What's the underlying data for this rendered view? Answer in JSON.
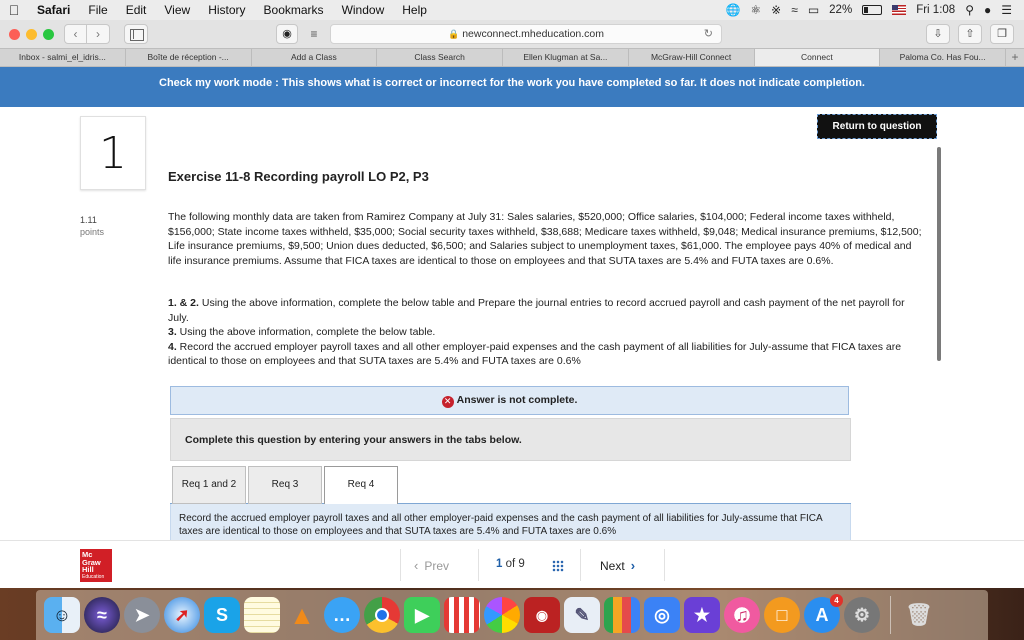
{
  "menubar": {
    "apple": "",
    "items": [
      "Safari",
      "File",
      "Edit",
      "View",
      "History",
      "Bookmarks",
      "Window",
      "Help"
    ],
    "battery": "22%",
    "clock": "Fri 1:08"
  },
  "toolbar": {
    "url": "newconnect.mheducation.com"
  },
  "tabs": [
    "Inbox - salmi_el_idris...",
    "Boîte de réception -...",
    "Add a Class",
    "Class Search",
    "Ellen Klugman at Sa...",
    "McGraw-Hill Connect",
    "Connect",
    "Paloma Co. Has Fou..."
  ],
  "active_tab_index": 6,
  "banner": {
    "text": "Check my work mode : This shows what is correct or incorrect for the work you have completed so far. It does not indicate completion."
  },
  "question": {
    "number": "1",
    "return_label": "Return to question",
    "title": "Exercise 11-8 Recording payroll LO P2, P3",
    "points_value": "1.11",
    "points_unit": "points",
    "body": "The following monthly data are taken from Ramirez Company at July 31: Sales salaries, $520,000; Office salaries, $104,000; Federal income taxes withheld, $156,000; State income taxes withheld, $35,000; Social security taxes withheld, $38,688; Medicare taxes withheld, $9,048; Medical insurance premiums, $12,500; Life insurance premiums, $9,500; Union dues deducted, $6,500; and Salaries subject to unemployment taxes, $61,000. The employee pays 40% of medical and life insurance premiums. Assume that FICA taxes are identical to those on employees and that SUTA taxes are 5.4% and FUTA taxes are 0.6%.",
    "instructions": [
      {
        "num": "1. & 2.",
        "text": " Using the above information, complete the below table and Prepare the journal entries to record accrued payroll and cash payment of the net payroll for July."
      },
      {
        "num": "3.",
        "text": " Using the above information, complete the below table."
      },
      {
        "num": "4.",
        "text": " Record the accrued employer payroll taxes and all other employer-paid expenses and the cash payment of all liabilities for July-assume that FICA taxes are identical to those on employees and that SUTA taxes are 5.4% and FUTA taxes are 0.6%"
      }
    ],
    "answer_status": "Answer is not complete.",
    "complete_prompt": "Complete this question by entering your answers in the tabs below.",
    "req_tabs": [
      "Req 1 and 2",
      "Req 3",
      "Req 4"
    ],
    "active_req_tab": 2,
    "req_content": "Record the accrued employer payroll taxes and all other employer-paid expenses and the cash payment of all liabilities for July-assume that FICA taxes are identical to those on employees and that SUTA taxes are 5.4% and FUTA taxes are 0.6%"
  },
  "footer": {
    "logo_lines": [
      "Mc",
      "Graw",
      "Hill",
      "Education"
    ],
    "prev_label": "Prev",
    "page_current": "1",
    "page_of": "of",
    "page_total": "9",
    "next_label": "Next"
  },
  "dock": {
    "icons": [
      "finder-icon",
      "siri-icon",
      "launchpad-icon",
      "safari-icon",
      "skype-icon",
      "notes-icon",
      "vlc-icon",
      "messages-icon",
      "chrome-icon",
      "facetime-icon",
      "popcorn-icon",
      "photos-icon",
      "photo-booth-icon",
      "preview-icon",
      "numbers-icon",
      "keynote-icon",
      "imovie-icon",
      "itunes-icon",
      "ibooks-icon",
      "app-store-icon",
      "system-preferences-icon",
      "trash-icon"
    ],
    "app_store_badge": "4"
  }
}
